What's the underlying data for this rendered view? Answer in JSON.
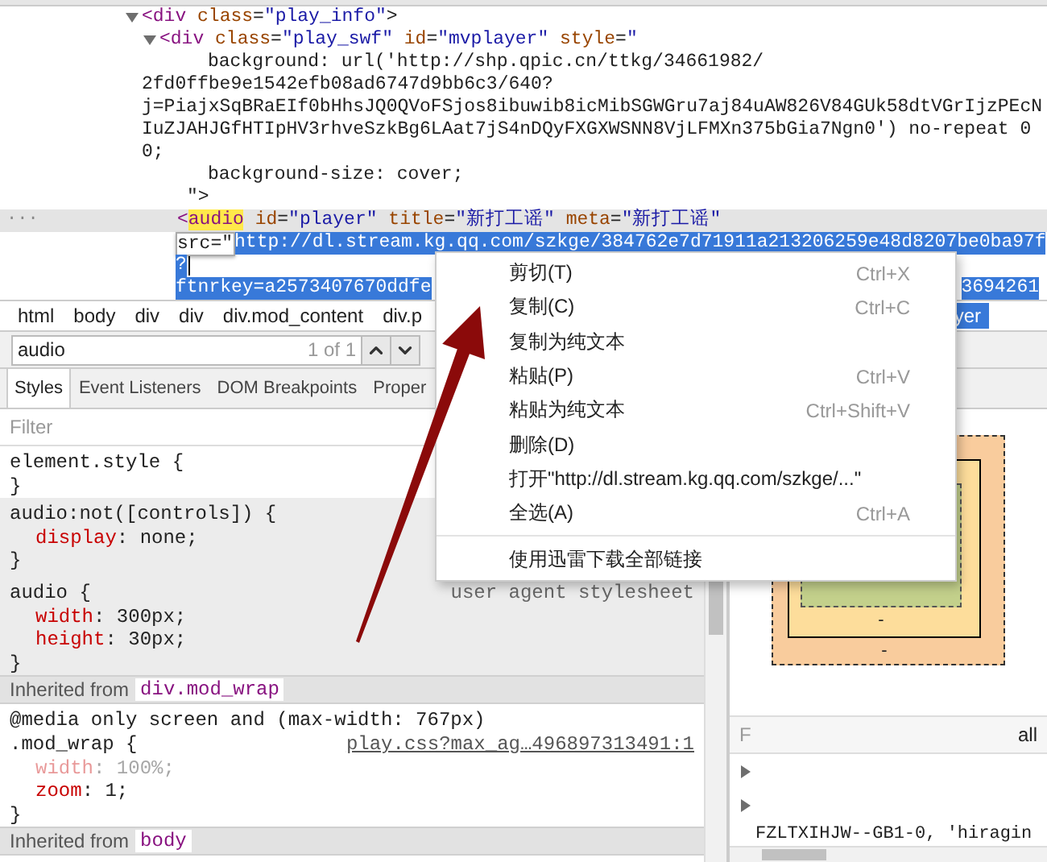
{
  "dom_tree": [
    {
      "text": "<div class=\"play_info\">",
      "expanded": true,
      "selected": false,
      "children": [
        {
          "text": "<div class=\"play_swf\" id=\"mvplayer\" style=\"",
          "expanded": true,
          "selected": false,
          "attr_lines": [
            {
              "kind": "decl",
              "text": "background: url('http://shp.qpic.cn/ttkg/34661982/"
            },
            {
              "kind": "wrap",
              "text": "2fd0ffbe9e1542efb08ad6747d9bb6c3/640?"
            },
            {
              "kind": "wrap",
              "text": "j=PiajxSqBRaEIf0bHhsJQ0QVoFSjos8ibuwib8icMibSGWGru7aj84uAW826V84GUk58dtVGrIjzPEcN"
            },
            {
              "kind": "wrap",
              "text": "IuZJAHJGfHTIpHV3rhveSzkBg6LAat7jS4nDQyFXGXWSNN8VjLFMXn375bGia7Ngn0') no-repeat 0"
            },
            {
              "kind": "wrap",
              "text": "0;"
            },
            {
              "kind": "decl",
              "text": "background-size: cover;"
            },
            {
              "kind": "close",
              "text": "\">"
            }
          ],
          "children": [
            {
              "text": "<audio id=\"player\" title=\"新打工谣\" meta=\"新打工谣\"",
              "selected": true,
              "search_match": true,
              "marker": "...",
              "editing": {
                "prefix": "src=\"",
                "lines": [
                  {
                    "text": "http://dl.stream.kg.qq.com/szkge/384762e7d71911a213206259e48d8207be0ba97f"
                  },
                  {
                    "text": "?",
                    "cursor": true
                  },
                  {
                    "text": "ftnrkey=a2573407670ddfe",
                    "tail": "3694261"
                  }
                ]
              }
            }
          ]
        }
      ]
    }
  ],
  "breadcrumbs": [
    {
      "label": "html",
      "selected": false
    },
    {
      "label": "body",
      "selected": false
    },
    {
      "label": "div",
      "selected": false
    },
    {
      "label": "div",
      "selected": false
    },
    {
      "label": "div.mod_content",
      "selected": false
    },
    {
      "label": "div.p",
      "selected": false
    },
    {
      "label": "yer",
      "selected": true
    }
  ],
  "search": {
    "value": "audio",
    "count": "1 of 1"
  },
  "style_tabs": [
    {
      "label": "Styles",
      "selected": true
    },
    {
      "label": "Event Listeners",
      "selected": false
    },
    {
      "label": "DOM Breakpoints",
      "selected": false
    },
    {
      "label": "Proper",
      "selected": false
    }
  ],
  "styles": {
    "filter_placeholder": "Filter",
    "blocks": [
      {
        "kind": "rule",
        "selector": "element.style {",
        "close": "}",
        "user_agent": false
      },
      {
        "kind": "rule",
        "selector": "audio:not([controls]) {",
        "close": "}",
        "user_agent": true,
        "declarations": [
          {
            "text": "display: none;",
            "overridden": false
          }
        ]
      },
      {
        "kind": "rule",
        "selector": "audio {",
        "close": "}",
        "user_agent": true,
        "source": "user agent stylesheet",
        "declarations": [
          {
            "text": "width: 300px;",
            "overridden": false
          },
          {
            "text": "height: 30px;",
            "overridden": false
          }
        ]
      },
      {
        "kind": "inherited",
        "label": "Inherited from",
        "element": "div.mod_wrap"
      },
      {
        "kind": "rule",
        "media": "@media only screen and (max-width: 767px)",
        "selector": ".mod_wrap {",
        "close": "}",
        "user_agent": false,
        "source_link": "play.css?max_ag…496897313491:1",
        "declarations": [
          {
            "text": "width: 100%;",
            "overridden": true
          },
          {
            "text": "zoom: 1;",
            "overridden": false
          }
        ]
      },
      {
        "kind": "inherited",
        "label": "Inherited from",
        "element": "body"
      }
    ]
  },
  "box_model": {
    "margin_bottom": "-",
    "border_bottom": "-"
  },
  "computed": {
    "filter_placeholder": "F",
    "show_all_label": "all",
    "rows": [
      {
        "expanded": false
      },
      {
        "expanded": false
      }
    ],
    "value_line": "FZLTXIHJW--GB1-0, 'hiragin"
  },
  "context_menu": [
    {
      "kind": "item",
      "label": "剪切(T)",
      "shortcut": "Ctrl+X"
    },
    {
      "kind": "item",
      "label": "复制(C)",
      "shortcut": "Ctrl+C"
    },
    {
      "kind": "item",
      "label": "复制为纯文本"
    },
    {
      "kind": "item",
      "label": "粘贴(P)",
      "shortcut": "Ctrl+V"
    },
    {
      "kind": "item",
      "label": "粘贴为纯文本",
      "shortcut": "Ctrl+Shift+V"
    },
    {
      "kind": "item",
      "label": "删除(D)"
    },
    {
      "kind": "item",
      "label": "打开\"http://dl.stream.kg.qq.com/szkge/...\""
    },
    {
      "kind": "item",
      "label": "全选(A)",
      "shortcut": "Ctrl+A"
    },
    {
      "kind": "separator"
    },
    {
      "kind": "item",
      "label": "使用迅雷下载全部链接"
    }
  ]
}
